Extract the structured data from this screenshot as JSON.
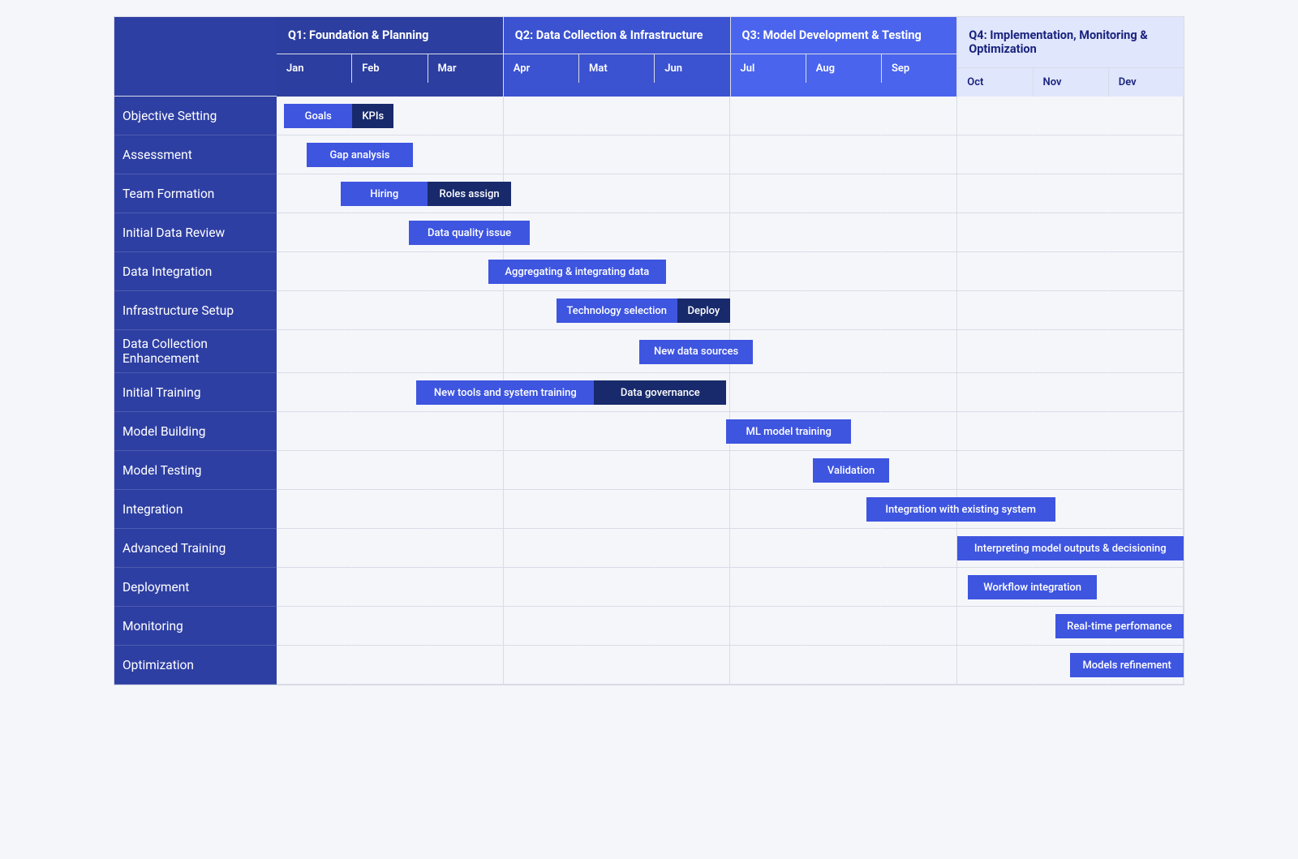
{
  "chart_data": {
    "type": "gantt",
    "quarters": [
      {
        "id": "q1",
        "label": "Q1: Foundation & Planning",
        "months": [
          "Jan",
          "Feb",
          "Mar"
        ],
        "fill": "#2c3e9f"
      },
      {
        "id": "q2",
        "label": "Q2: Data Collection & Infrastructure",
        "months": [
          "Apr",
          "Mat",
          "Jun"
        ],
        "fill": "#3b52d1"
      },
      {
        "id": "q3",
        "label": "Q3: Model Development & Testing",
        "months": [
          "Jul",
          "Aug",
          "Sep"
        ],
        "fill": "#4a64ed"
      },
      {
        "id": "q4",
        "label": "Q4: Implementation, Monitoring & Optimization",
        "months": [
          "Oct",
          "Nov",
          "Dev"
        ],
        "fill": "#e0e6fb"
      }
    ],
    "rows": [
      {
        "label": "Objective Setting",
        "tasks": [
          {
            "text": "Goals",
            "start": 0.1,
            "end": 1.0,
            "style": "light"
          },
          {
            "text": "KPIs",
            "start": 1.0,
            "end": 1.55,
            "style": "dark"
          }
        ]
      },
      {
        "label": "Assessment",
        "tasks": [
          {
            "text": "Gap analysis",
            "start": 0.4,
            "end": 1.8,
            "style": "light"
          }
        ]
      },
      {
        "label": "Team Formation",
        "tasks": [
          {
            "text": "Hiring",
            "start": 0.85,
            "end": 2.0,
            "style": "light"
          },
          {
            "text": "Roles assign",
            "start": 2.0,
            "end": 3.1,
            "style": "dark"
          }
        ]
      },
      {
        "label": "Initial Data Review",
        "tasks": [
          {
            "text": "Data quality issue",
            "start": 1.75,
            "end": 3.35,
            "style": "light"
          }
        ]
      },
      {
        "label": "Data Integration",
        "tasks": [
          {
            "text": "Aggregating & integrating data",
            "start": 2.8,
            "end": 5.15,
            "style": "light"
          }
        ]
      },
      {
        "label": "Infrastructure Setup",
        "tasks": [
          {
            "text": "Technology selection",
            "start": 3.7,
            "end": 5.3,
            "style": "light"
          },
          {
            "text": "Deploy",
            "start": 5.3,
            "end": 6.0,
            "style": "dark"
          }
        ]
      },
      {
        "label": "Data Collection Enhancement",
        "tasks": [
          {
            "text": "New data sources",
            "start": 4.8,
            "end": 6.3,
            "style": "light"
          }
        ]
      },
      {
        "label": "Initial Training",
        "tasks": [
          {
            "text": "New tools and system training",
            "start": 1.85,
            "end": 4.2,
            "style": "light"
          },
          {
            "text": "Data governance",
            "start": 4.2,
            "end": 5.95,
            "style": "dark"
          }
        ]
      },
      {
        "label": "Model Building",
        "tasks": [
          {
            "text": "ML model training",
            "start": 5.95,
            "end": 7.6,
            "style": "light"
          }
        ]
      },
      {
        "label": "Model Testing",
        "tasks": [
          {
            "text": "Validation",
            "start": 7.1,
            "end": 8.1,
            "style": "light"
          }
        ]
      },
      {
        "label": "Integration",
        "tasks": [
          {
            "text": "Integration with existing system",
            "start": 7.8,
            "end": 10.3,
            "style": "light"
          }
        ]
      },
      {
        "label": "Advanced Training",
        "tasks": [
          {
            "text": "Interpreting model outputs & decisioning",
            "start": 9.0,
            "end": 12.0,
            "style": "light"
          }
        ]
      },
      {
        "label": "Deployment",
        "tasks": [
          {
            "text": "Workflow integration",
            "start": 9.15,
            "end": 10.85,
            "style": "light"
          }
        ]
      },
      {
        "label": "Monitoring",
        "tasks": [
          {
            "text": "Real-time perfomance",
            "start": 10.3,
            "end": 12.0,
            "style": "light"
          }
        ]
      },
      {
        "label": "Optimization",
        "tasks": [
          {
            "text": "Models refinement",
            "start": 10.5,
            "end": 12.0,
            "style": "light"
          }
        ]
      }
    ],
    "months_total": 12
  }
}
